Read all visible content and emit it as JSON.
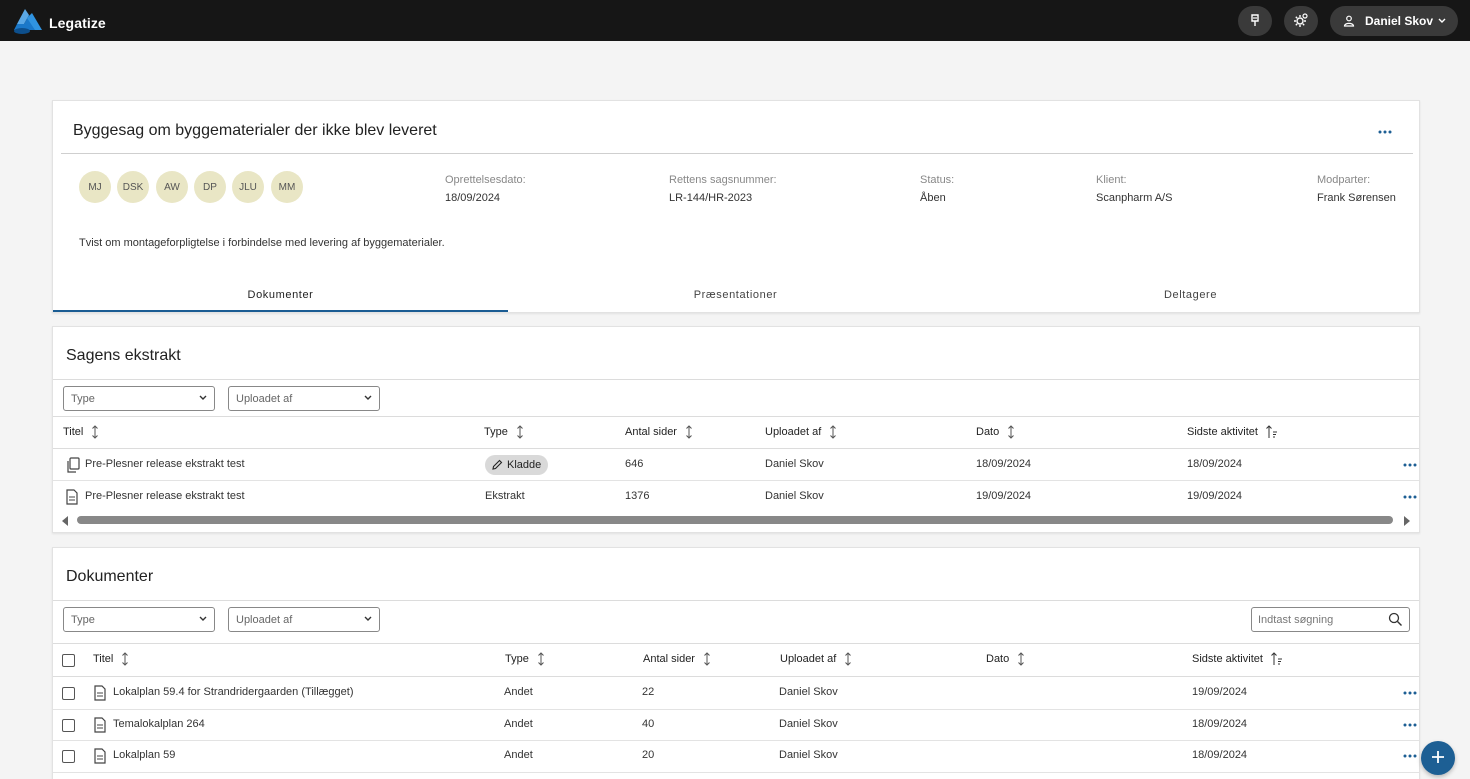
{
  "header": {
    "logo_text": "Legatize",
    "user_name": "Daniel Skov",
    "icons": [
      "pin-icon",
      "settings-gear-icon",
      "user-icon",
      "chevron-down-icon"
    ]
  },
  "case": {
    "title": "Byggesag om byggematerialer der ikke blev leveret",
    "participants": [
      "MJ",
      "DSK",
      "AW",
      "DP",
      "JLU",
      "MM"
    ],
    "meta": [
      {
        "label": "Oprettelsesdato:",
        "value": "18/09/2024"
      },
      {
        "label": "Rettens sagsnummer:",
        "value": "LR-144/HR-2023"
      },
      {
        "label": "Status:",
        "value": "Åben"
      },
      {
        "label": "Klient:",
        "value": "Scanpharm A/S"
      },
      {
        "label": "Modparter:",
        "value": "Frank Sørensen"
      }
    ],
    "description": "Tvist om montageforpligtelse i forbindelse med levering af byggematerialer.",
    "tabs": [
      {
        "label": "Dokumenter",
        "active": true
      },
      {
        "label": "Præsentationer",
        "active": false
      },
      {
        "label": "Deltagere",
        "active": false
      }
    ]
  },
  "extract": {
    "title": "Sagens ekstrakt",
    "filters": {
      "type_placeholder": "Type",
      "uploader_placeholder": "Uploadet af"
    },
    "columns": [
      "Titel",
      "Type",
      "Antal sider",
      "Uploadet af",
      "Dato",
      "Sidste aktivitet"
    ],
    "rows": [
      {
        "title": "Pre-Plesner release ekstrakt test",
        "type": "Kladde",
        "type_is_chip": true,
        "pages": "646",
        "uploader": "Daniel Skov",
        "date": "18/09/2024",
        "last_activity": "18/09/2024"
      },
      {
        "title": "Pre-Plesner release ekstrakt test",
        "type": "Ekstrakt",
        "type_is_chip": false,
        "pages": "1376",
        "uploader": "Daniel Skov",
        "date": "19/09/2024",
        "last_activity": "19/09/2024"
      }
    ]
  },
  "documents": {
    "title": "Dokumenter",
    "filters": {
      "type_placeholder": "Type",
      "uploader_placeholder": "Uploadet af"
    },
    "search_placeholder": "Indtast søgning",
    "columns": [
      "Titel",
      "Type",
      "Antal sider",
      "Uploadet af",
      "Dato",
      "Sidste aktivitet"
    ],
    "rows": [
      {
        "title": "Lokalplan 59.4 for Strandridergaarden (Tillægget)",
        "type": "Andet",
        "pages": "22",
        "uploader": "Daniel Skov",
        "date": "",
        "last_activity": "19/09/2024"
      },
      {
        "title": "Temalokalplan 264",
        "type": "Andet",
        "pages": "40",
        "uploader": "Daniel Skov",
        "date": "",
        "last_activity": "18/09/2024"
      },
      {
        "title": "Lokalplan 59",
        "type": "Andet",
        "pages": "20",
        "uploader": "Daniel Skov",
        "date": "",
        "last_activity": "18/09/2024"
      }
    ]
  },
  "colors": {
    "accent": "#1d5f94",
    "topbar": "#161616",
    "avatar_bg": "#e9e6c5"
  }
}
